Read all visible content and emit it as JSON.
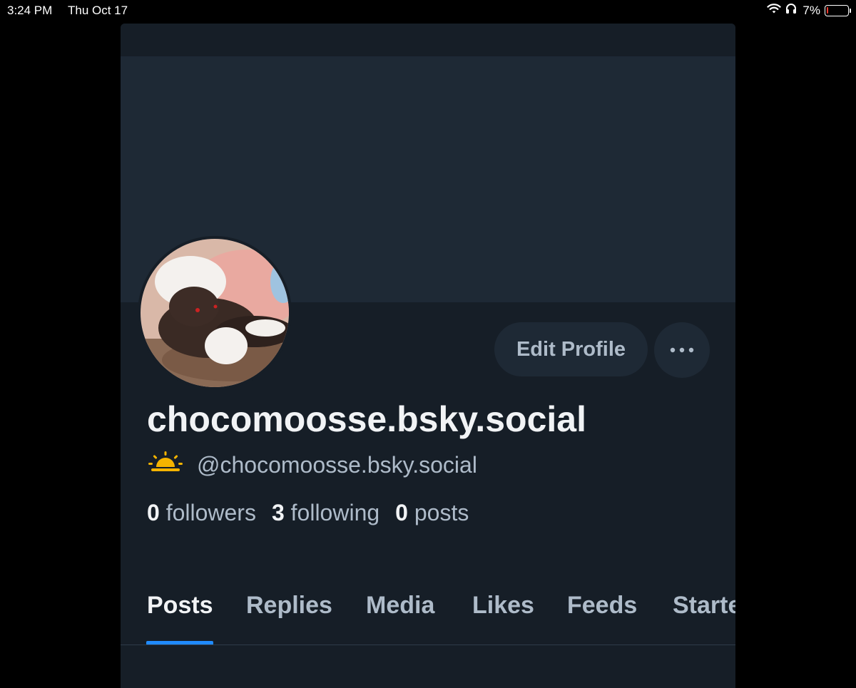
{
  "status_bar": {
    "time": "3:24 PM",
    "date": "Thu Oct 17",
    "battery": "7%",
    "battery_level": 0.07
  },
  "profile": {
    "display_name": "chocomoosse.bsky.social",
    "handle": "@chocomoosse.bsky.social",
    "handle_emoji": "sunrise-emoji",
    "edit_button_label": "Edit Profile",
    "more_icon": "ellipsis-icon",
    "stats": {
      "followers_count": "0",
      "followers_label": "followers",
      "following_count": "3",
      "following_label": "following",
      "posts_count": "0",
      "posts_label": "posts"
    }
  },
  "tabs": [
    {
      "label": "Posts",
      "active": true
    },
    {
      "label": "Replies",
      "active": false
    },
    {
      "label": "Media",
      "active": false
    },
    {
      "label": "Likes",
      "active": false
    },
    {
      "label": "Feeds",
      "active": false
    },
    {
      "label": "Starte",
      "active": false
    }
  ],
  "colors": {
    "background": "#000000",
    "panel": "#161e27",
    "banner": "#1e2935",
    "accent": "#208bfe",
    "text_primary": "#f1f3f5",
    "text_secondary": "#aebbc9",
    "battery_low": "#ff3b30"
  }
}
